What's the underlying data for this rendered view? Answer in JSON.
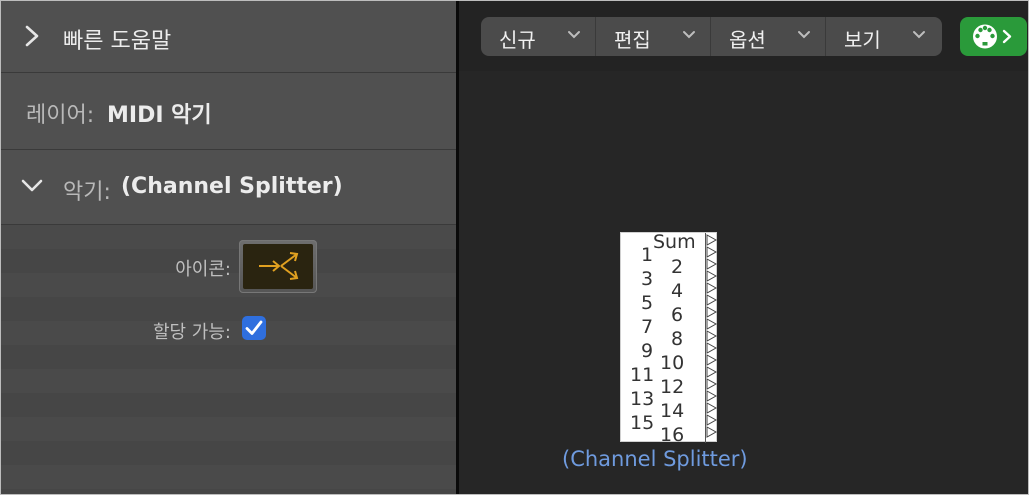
{
  "inspector": {
    "quick_help_label": "빠른 도움말",
    "layer_prefix": "레이어:",
    "layer_value": "MIDI 악기",
    "instrument_prefix": "악기:",
    "instrument_value": "(Channel Splitter)",
    "icon_label": "아이콘:",
    "assignable_label": "할당 가능:",
    "assignable_checked": true
  },
  "toolbar": {
    "menus": [
      {
        "label": "신규"
      },
      {
        "label": "편집"
      },
      {
        "label": "옵션"
      },
      {
        "label": "보기"
      }
    ],
    "midi_button_icon": "midi-connector-icon"
  },
  "splitter": {
    "header": "Sum",
    "left_numbers": [
      "1",
      "3",
      "5",
      "7",
      "9",
      "11",
      "13",
      "15"
    ],
    "right_numbers": [
      "2",
      "4",
      "6",
      "8",
      "10",
      "12",
      "14",
      "16"
    ],
    "name": "(Channel Splitter)"
  },
  "colors": {
    "accent_blue": "#2f6fde",
    "midi_green": "#2a9a3a",
    "object_name_blue": "#6f9bdf",
    "icon_orange": "#e0a020"
  }
}
